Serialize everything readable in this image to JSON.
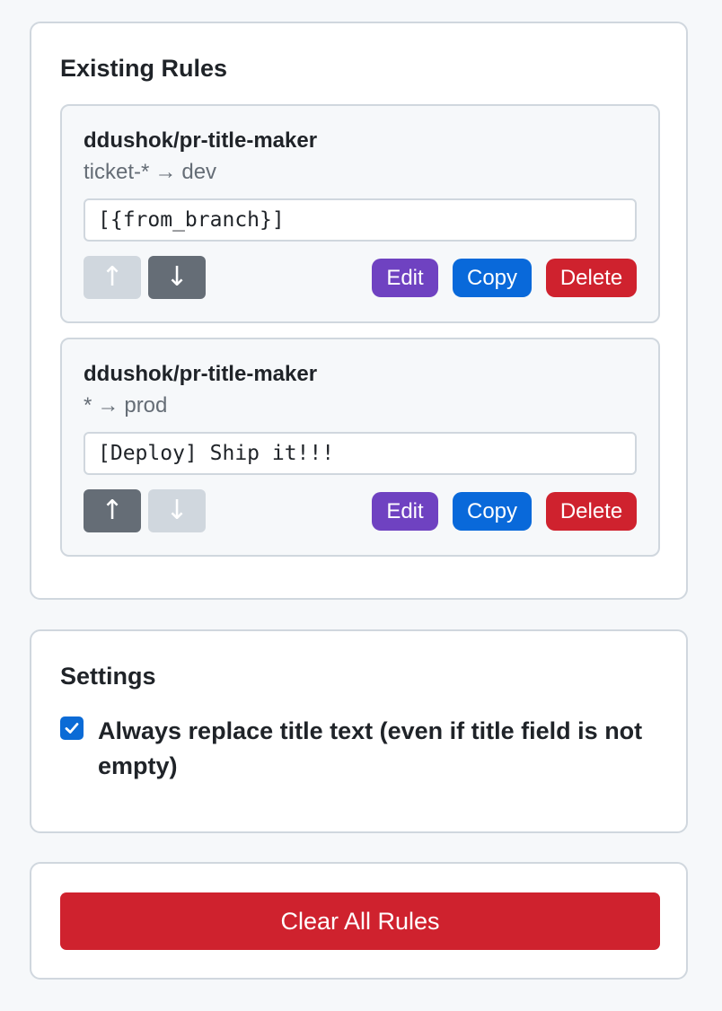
{
  "rules_section": {
    "title": "Existing Rules",
    "rules": [
      {
        "repo": "ddushok/pr-title-maker",
        "from_branch": "ticket-*",
        "arrow": "→",
        "to_branch": "dev",
        "template": "[{from_branch}]",
        "up_enabled": false,
        "down_enabled": true
      },
      {
        "repo": "ddushok/pr-title-maker",
        "from_branch": "*",
        "arrow": "→",
        "to_branch": "prod",
        "template": "[Deploy] Ship it!!!",
        "up_enabled": true,
        "down_enabled": false
      }
    ],
    "buttons": {
      "up_label": "↑",
      "down_label": "↓",
      "edit_label": "Edit",
      "copy_label": "Copy",
      "delete_label": "Delete"
    }
  },
  "settings_section": {
    "title": "Settings",
    "always_replace": {
      "label": "Always replace title text (even if title field is not empty)",
      "checked": true
    }
  },
  "clear_section": {
    "clear_label": "Clear All Rules"
  },
  "colors": {
    "edit": "#6f42c1",
    "copy": "#0969da",
    "delete": "#cf222e",
    "move_enabled": "#656d76",
    "move_disabled": "#d0d7de",
    "checkbox": "#0b6bd6"
  }
}
